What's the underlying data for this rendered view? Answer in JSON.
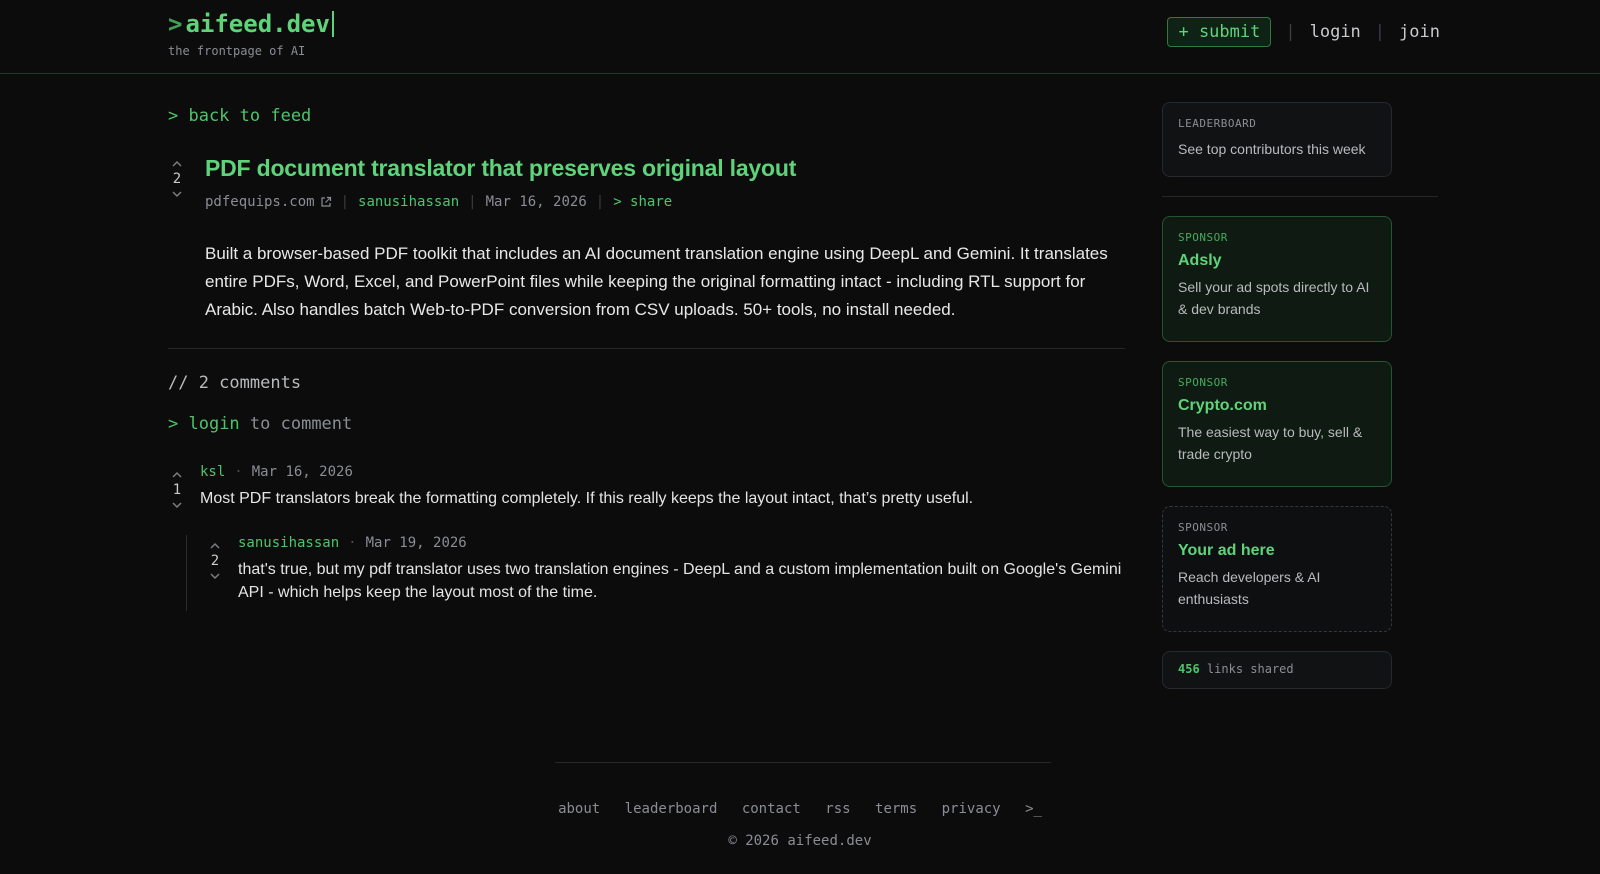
{
  "brand": {
    "prompt": ">",
    "name": "aifeed.dev",
    "tagline": "the frontpage of AI"
  },
  "nav": {
    "submit": "+ submit",
    "login": "login",
    "join": "join",
    "separator": "|"
  },
  "back_link": "> back to feed",
  "post": {
    "votes": "2",
    "title": "PDF document translator that preserves original layout",
    "domain": "pdfequips.com",
    "author": "sanusihassan",
    "date": "Mar 16, 2026",
    "share": "> share",
    "body": "Built a browser-based PDF toolkit that includes an AI document translation engine using DeepL and Gemini. It translates entire PDFs, Word, Excel, and PowerPoint files while keeping the original formatting intact - including RTL support for Arabic. Also handles batch Web-to-PDF conversion from CSV uploads. 50+ tools, no install needed."
  },
  "comments_header": "// 2 comments",
  "login_prompt": {
    "prefix": "> ",
    "link": "login",
    "suffix": " to comment"
  },
  "comments": [
    {
      "votes": "1",
      "author": "ksl",
      "date": "Mar 16, 2026",
      "text": "Most PDF translators break the formatting completely. If this really keeps the layout intact, that’s pretty useful."
    },
    {
      "votes": "2",
      "author": "sanusihassan",
      "date": "Mar 19, 2026",
      "text": "that's true, but my pdf translator uses two translation engines - DeepL and a custom implementation built on Google's Gemini API - which helps keep the layout most of the time."
    }
  ],
  "sidebar": {
    "leaderboard": {
      "label": "LEADERBOARD",
      "desc": "See top contributors this week"
    },
    "sponsors": [
      {
        "label": "SPONSOR",
        "title": "Adsly",
        "desc": "Sell your ad spots directly to AI & dev brands"
      },
      {
        "label": "SPONSOR",
        "title": "Crypto.com",
        "desc": "The easiest way to buy, sell & trade crypto"
      },
      {
        "label": "SPONSOR",
        "title": "Your ad here",
        "desc": "Reach developers & AI enthusiasts"
      }
    ],
    "stats": {
      "count": "456",
      "label": "links shared"
    }
  },
  "footer": {
    "links": [
      "about",
      "leaderboard",
      "contact",
      "rss",
      "terms",
      "privacy",
      ">_"
    ],
    "copyright": "© 2026 aifeed.dev"
  },
  "colors": {
    "accent": "#5fd37a",
    "background": "#0c0c0d",
    "muted": "#8a8d93"
  },
  "icons": {
    "upvote": "chevron-up-icon",
    "downvote": "chevron-down-icon",
    "external": "external-link-icon"
  }
}
